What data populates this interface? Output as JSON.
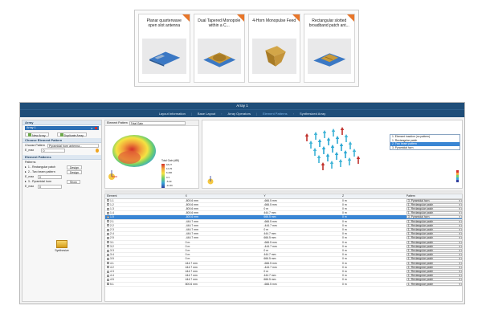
{
  "templates": [
    {
      "title": "Planar quarterwave open slot antenna"
    },
    {
      "title": "Dual Tapered Monopole within a C..."
    },
    {
      "title": "4-Horn Monopulse Feed"
    },
    {
      "title": "Rectangular slotted broadband patch ant..."
    }
  ],
  "window": {
    "title": "Array 1"
  },
  "tabs": [
    "Layout Information",
    "Base Layout",
    "Array Operators",
    "Element Patterns",
    "Synthesized Array"
  ],
  "left_panel": {
    "array_section": "Array",
    "array_item": "Array 1",
    "new_array": "New Array",
    "duplicate_array": "Duplicate Array",
    "choose_pattern_section": "Choose Element Pattern",
    "choose_pattern_label": "Choose Pattern",
    "choose_pattern_value": "Pyramidal horn antenna...",
    "e_max_label": "E_max",
    "e_max_value": "0",
    "element_patterns_section": "Element Patterns",
    "patterns_label": "Patterns",
    "patterns": [
      {
        "name": "1 - Rectangular patch",
        "action": "Design"
      },
      {
        "name": "2 - Two beam pattern",
        "action": "Design"
      },
      {
        "name": "3 - Pyramidal horn",
        "action": "Show"
      }
    ],
    "synthesize": "Synthesize"
  },
  "pattern_view": {
    "label": "Element Pattern",
    "selected": "Total Gain",
    "legend_title": "Total Gain (dBi)",
    "legend_values": [
      "18.27",
      "12.29",
      "6.296",
      "0.3",
      "-5.69",
      "-11.69",
      "-17.69"
    ]
  },
  "table": {
    "headers": [
      "Element",
      "X",
      "Y",
      "Z",
      "Pattern"
    ],
    "rows": [
      {
        "e": "1.1",
        "x": "-800.6 mm",
        "y": "-666.5 mm",
        "z": "0 m",
        "p": "3. Pyramidal horn"
      },
      {
        "e": "1.2",
        "x": "-800.6 mm",
        "y": "-666.5 mm",
        "z": "0 m",
        "p": "1. Rectangular patch"
      },
      {
        "e": "1.3",
        "x": "-800.6 mm",
        "y": "0 m",
        "z": "0 m",
        "p": "1. Rectangular patch"
      },
      {
        "e": "1.4",
        "x": "-800.6 mm",
        "y": "444.7 mm",
        "z": "0 m",
        "p": "1. Rectangular patch"
      },
      {
        "e": "1.5",
        "x": "-800.6 mm",
        "y": "666.5 mm",
        "z": "0 m",
        "p": "3. Pyramidal horn"
      },
      {
        "e": "2.1",
        "x": "-444.7 mm",
        "y": "-666.5 mm",
        "z": "0 m",
        "p": "1. Rectangular patch"
      },
      {
        "e": "2.2",
        "x": "-444.7 mm",
        "y": "-444.7 mm",
        "z": "0 m",
        "p": "1. Rectangular patch"
      },
      {
        "e": "2.3",
        "x": "-444.7 mm",
        "y": "0 m",
        "z": "0 m",
        "p": "1. Rectangular patch"
      },
      {
        "e": "2.4",
        "x": "-444.7 mm",
        "y": "444.7 mm",
        "z": "0 m",
        "p": "1. Rectangular patch"
      },
      {
        "e": "2.5",
        "x": "-444.7 mm",
        "y": "666.5 mm",
        "z": "0 m",
        "p": "1. Rectangular patch"
      },
      {
        "e": "3.1",
        "x": "0 m",
        "y": "-666.5 mm",
        "z": "0 m",
        "p": "1. Rectangular patch"
      },
      {
        "e": "3.2",
        "x": "0 m",
        "y": "-444.7 mm",
        "z": "0 m",
        "p": "1. Rectangular patch"
      },
      {
        "e": "3.3",
        "x": "0 m",
        "y": "0 m",
        "z": "0 m",
        "p": "1. Rectangular patch"
      },
      {
        "e": "3.4",
        "x": "0 m",
        "y": "444.7 mm",
        "z": "0 m",
        "p": "1. Rectangular patch"
      },
      {
        "e": "3.5",
        "x": "0 m",
        "y": "666.5 mm",
        "z": "0 m",
        "p": "1. Rectangular patch"
      },
      {
        "e": "4.1",
        "x": "444.7 mm",
        "y": "-666.5 mm",
        "z": "0 m",
        "p": "1. Rectangular patch"
      },
      {
        "e": "4.2",
        "x": "444.7 mm",
        "y": "-444.7 mm",
        "z": "0 m",
        "p": "1. Rectangular patch"
      },
      {
        "e": "4.3",
        "x": "444.7 mm",
        "y": "0 m",
        "z": "0 m",
        "p": "1. Rectangular patch"
      },
      {
        "e": "4.4",
        "x": "444.7 mm",
        "y": "444.7 mm",
        "z": "0 m",
        "p": "1. Rectangular patch"
      },
      {
        "e": "4.5",
        "x": "444.7 mm",
        "y": "666.5 mm",
        "z": "0 m",
        "p": "1. Rectangular patch"
      },
      {
        "e": "5.1",
        "x": "800.6 mm",
        "y": "-666.5 mm",
        "z": "0 m",
        "p": "1. Rectangular patch"
      }
    ],
    "selected_index": 4
  },
  "dropdown_options": [
    "1. Element inactive (no pattern)",
    "1. Rectangular patch",
    "2. Two beam pattern",
    "3. Pyramidal horn"
  ],
  "colors": {
    "title_bar": "#1f4e79",
    "selection": "#3a86d4",
    "accent": "#e8762a",
    "blue_patch": "#3b78c4",
    "gold_patch": "#c99a3a"
  }
}
